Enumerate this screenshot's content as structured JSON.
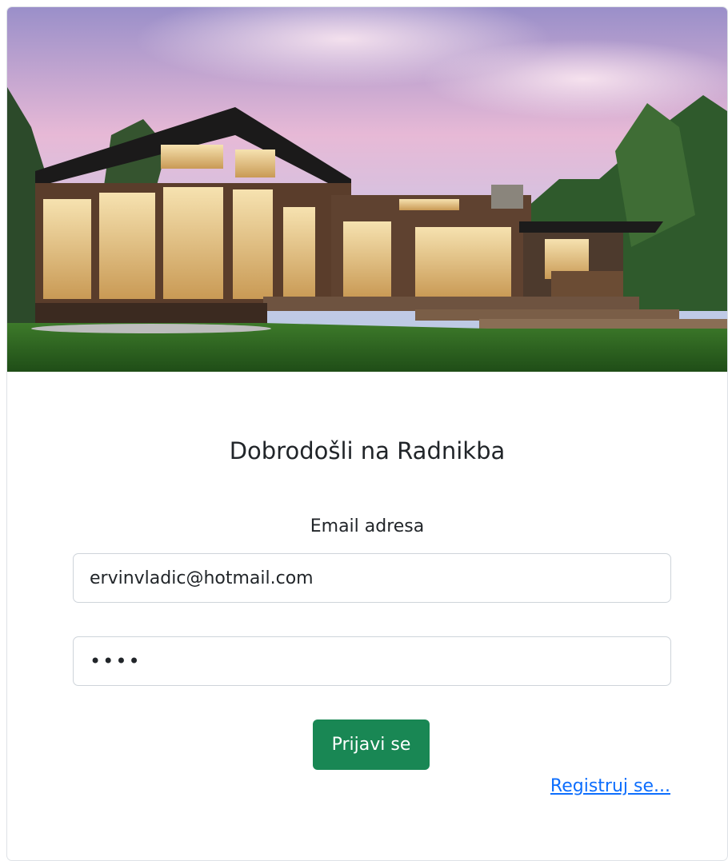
{
  "login": {
    "title": "Dobrodošli na Radnikba",
    "email_label": "Email adresa",
    "email_value": "ervinvladic@hotmail.com",
    "password_value": "1234",
    "submit_label": "Prijavi se",
    "register_link": "Registruj se..."
  },
  "colors": {
    "button": "#198754",
    "link": "#0d6efd",
    "text": "#212529",
    "border": "#ced4da"
  }
}
